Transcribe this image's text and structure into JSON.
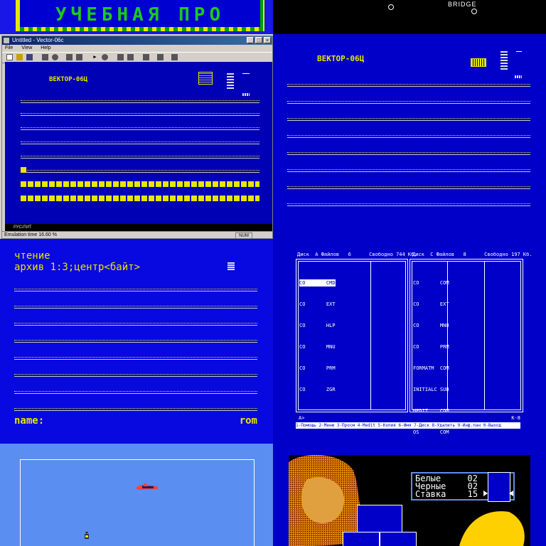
{
  "tile1": {
    "title": "УЧЕБНАЯ ПРО"
  },
  "tile2": {
    "word": "BRIDGE"
  },
  "emulator": {
    "window_title": "Untitled - Vector-06c",
    "menu": [
      "File",
      "View",
      "Help"
    ],
    "screen_label": "ВЕКТОР-06Ц",
    "taskbar_text": "РУС/ЛИТ",
    "status_text": "Emulation time 16.60 %",
    "status_num": "NUM"
  },
  "tile4": {
    "screen_label": "ВЕКТОР-06Ц"
  },
  "tile5": {
    "line1": "чтение",
    "line2": "архив 1:3;центр<байт>",
    "name_label": "name:",
    "rom_label": "rom"
  },
  "filemanager": {
    "left_header": "Диск  A Файлов   6      Свободно 744 Кб.",
    "right_header": "Диск  C Файлов   8      Свободно 197 Кб.",
    "left_files": [
      "CO       CMD",
      "CO       EXT",
      "CO       HLP",
      "CO       MNU",
      "CO       PRM",
      "CO       ZGR"
    ],
    "right_files": [
      "CO       COM",
      "CO       EXT",
      "CO       MNU",
      "CO       PRM",
      "FORMATM  COM",
      "INITIALC SUB",
      "MEDIT    COM",
      "OS       COM"
    ],
    "prompt": "A>",
    "drive_label": "K-8",
    "fkeys": "1-Помощь 2-Меню 3-Просм 4-Medit 5-Копия 6-Имя 7-Диск 8-Удалить 9-Инф.пан 0-Выход"
  },
  "tile8": {
    "rows": [
      {
        "label": "Белые",
        "value": "02"
      },
      {
        "label": "Черные",
        "value": "02"
      },
      {
        "label": "Ставка",
        "value": "15"
      }
    ]
  }
}
